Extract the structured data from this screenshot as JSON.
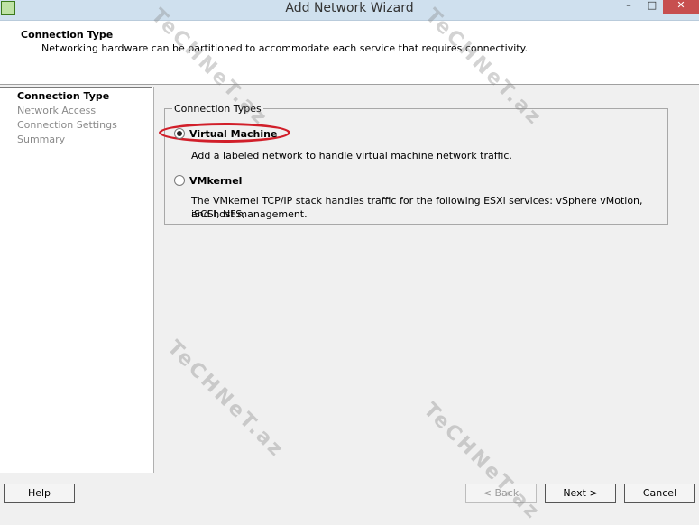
{
  "window": {
    "title": "Add Network Wizard",
    "minimize_glyph": "–",
    "maximize_glyph": "□",
    "close_glyph": "✕"
  },
  "header": {
    "title": "Connection Type",
    "description": "Networking hardware can be partitioned to accommodate each service that requires connectivity."
  },
  "sidebar": {
    "items": [
      {
        "label": "Connection Type"
      },
      {
        "label": "Network Access"
      },
      {
        "label": "Connection Settings"
      },
      {
        "label": "Summary"
      }
    ]
  },
  "connection_types": {
    "group_label": "Connection Types",
    "options": [
      {
        "label": "Virtual Machine",
        "description": "Add a labeled network to handle virtual machine network traffic."
      },
      {
        "label": "VMkernel",
        "description_line1": "The VMkernel TCP/IP stack handles traffic for the following ESXi services: vSphere vMotion, iSCSI, NFS,",
        "description_line2": "and host management."
      }
    ]
  },
  "footer": {
    "help": "Help",
    "back": "< Back",
    "next": "Next >",
    "cancel": "Cancel"
  },
  "watermark": {
    "text": "TeCHNeT.az"
  },
  "colors": {
    "highlight": "#d11f2a",
    "titlebar": "#cfe0ee",
    "close_button": "#c74f4f"
  }
}
